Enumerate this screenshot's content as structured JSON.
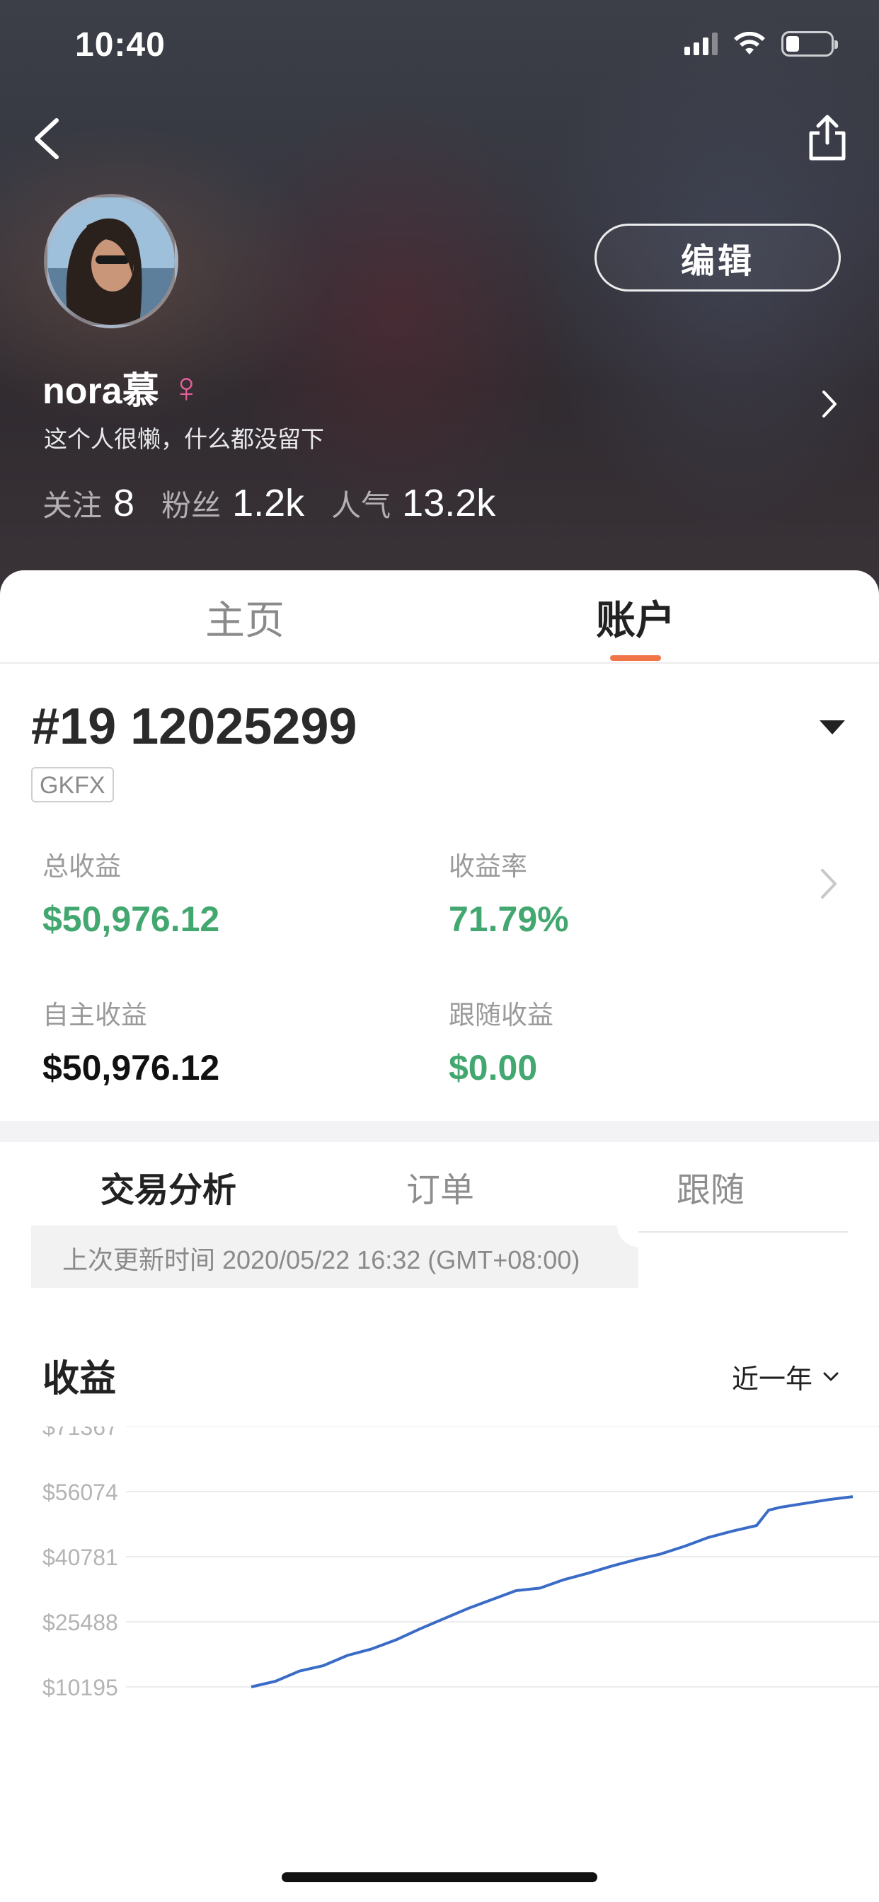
{
  "status_bar": {
    "time": "10:40"
  },
  "profile": {
    "name": "nora慕",
    "gender_symbol": "♀",
    "bio": "这个人很懒，什么都没留下",
    "edit_label": "编辑",
    "stats": [
      {
        "label": "关注",
        "value": "8"
      },
      {
        "label": "粉丝",
        "value": "1.2k"
      },
      {
        "label": "人气",
        "value": "13.2k"
      }
    ]
  },
  "main_tabs": [
    {
      "label": "主页",
      "active": false
    },
    {
      "label": "账户",
      "active": true
    }
  ],
  "account": {
    "number": "#19 12025299",
    "broker": "GKFX",
    "metrics": [
      {
        "label": "总收益",
        "value": "$50,976.12",
        "color": "#43a770"
      },
      {
        "label": "收益率",
        "value": "71.79%",
        "color": "#43a770"
      },
      {
        "label": "自主收益",
        "value": "$50,976.12",
        "color": "#111111"
      },
      {
        "label": "跟随收益",
        "value": "$0.00",
        "color": "#43a770"
      }
    ]
  },
  "sub_tabs": [
    {
      "label": "交易分析",
      "active": true
    },
    {
      "label": "订单",
      "active": false
    },
    {
      "label": "跟随",
      "active": false
    }
  ],
  "update_text": "上次更新时间 2020/05/22 16:32 (GMT+08:00)",
  "earnings": {
    "title": "收益",
    "range": "近一年"
  },
  "colors": {
    "accent": "#f07648",
    "positive": "#43a770",
    "line": "#3a6bc6"
  },
  "chart_data": {
    "type": "line",
    "title": "收益",
    "y_ticks": [
      "$71367",
      "$56074",
      "$40781",
      "$25488",
      "$10195"
    ],
    "ylim": [
      10195,
      71367
    ],
    "xlim": [
      0,
      1
    ],
    "grid": true,
    "series": [
      {
        "x": [
          0.0,
          0.04,
          0.08,
          0.12,
          0.16,
          0.2,
          0.24,
          0.28,
          0.32,
          0.36,
          0.4,
          0.44,
          0.48,
          0.52,
          0.56,
          0.6,
          0.64,
          0.68,
          0.72,
          0.76,
          0.8,
          0.84,
          0.86,
          0.88,
          0.92,
          0.96,
          1.0
        ],
        "y": [
          10195,
          11500,
          13900,
          15200,
          17600,
          19100,
          21200,
          23800,
          26200,
          28600,
          30700,
          32800,
          33400,
          35400,
          36900,
          38600,
          40100,
          41400,
          43200,
          45300,
          46800,
          48100,
          51700,
          52400,
          53300,
          54200,
          54900
        ]
      }
    ]
  }
}
